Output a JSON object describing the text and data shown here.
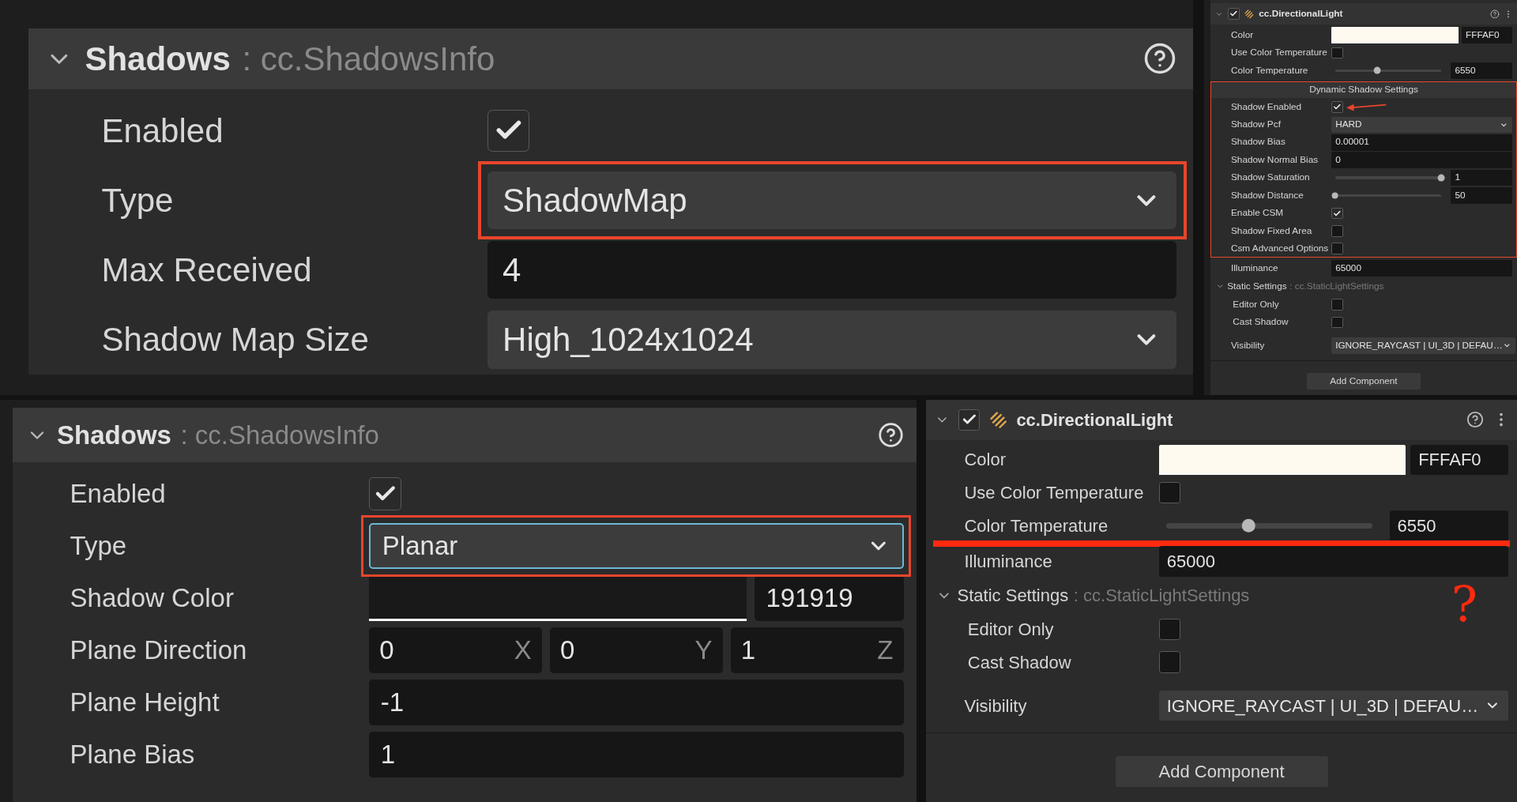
{
  "panels": [
    {
      "kind": "scene",
      "header": {
        "title": "Shadows",
        "type": ": cc.ShadowsInfo",
        "expanded": true
      },
      "rows": [
        {
          "kind": "checkbox",
          "label": "Enabled",
          "checked": true
        },
        {
          "kind": "select",
          "label": "Type",
          "value": "ShadowMap",
          "highlighted": true,
          "focused": false
        },
        {
          "kind": "number",
          "label": "Max Received",
          "value": "4"
        },
        {
          "kind": "select",
          "label": "Shadow Map Size",
          "value": "High_1024x1024",
          "focused": false
        }
      ]
    },
    {
      "kind": "component",
      "header": {
        "title": "cc.DirectionalLight",
        "enabled": true,
        "expanded": true
      },
      "rows": [
        {
          "kind": "color",
          "label": "Color",
          "value": "FFFAF0"
        },
        {
          "kind": "checkbox",
          "label": "Use Color Temperature",
          "checked": false
        },
        {
          "kind": "slider",
          "label": "Color Temperature",
          "level": 0.4,
          "value": "6550"
        },
        {
          "kind": "group",
          "title": "Dynamic Shadow Settings",
          "highlighted": true,
          "children": [
            {
              "kind": "checkbox",
              "label": "Shadow Enabled",
              "checked": true,
              "arrow": true
            },
            {
              "kind": "select",
              "label": "Shadow Pcf",
              "value": "HARD",
              "focused": false
            },
            {
              "kind": "number",
              "label": "Shadow Bias",
              "value": "0.00001"
            },
            {
              "kind": "number",
              "label": "Shadow Normal Bias",
              "value": "0"
            },
            {
              "kind": "slider",
              "label": "Shadow Saturation",
              "level": 1,
              "value": "1"
            },
            {
              "kind": "slider",
              "label": "Shadow Distance",
              "level": 0,
              "value": "50"
            },
            {
              "kind": "checkbox",
              "label": "Enable CSM",
              "checked": true
            },
            {
              "kind": "checkbox",
              "label": "Shadow Fixed Area",
              "checked": false
            },
            {
              "kind": "checkbox",
              "label": "Csm Advanced Options",
              "checked": false
            }
          ]
        },
        {
          "kind": "number",
          "label": "Illuminance",
          "value": "65000"
        },
        {
          "kind": "section",
          "title": "Static Settings",
          "type": ": cc.StaticLightSettings",
          "expanded": true,
          "children": [
            {
              "kind": "checkbox",
              "label": "Editor Only",
              "checked": false
            },
            {
              "kind": "checkbox",
              "label": "Cast Shadow",
              "checked": false
            }
          ]
        },
        {
          "kind": "select",
          "label": "Visibility",
          "value": "IGNORE_RAYCAST | UI_3D | DEFAU…",
          "focused": false
        }
      ],
      "button": "Add Component"
    },
    {
      "kind": "scene",
      "header": {
        "title": "Shadows",
        "type": ": cc.ShadowsInfo",
        "expanded": true
      },
      "rows": [
        {
          "kind": "checkbox",
          "label": "Enabled",
          "checked": true
        },
        {
          "kind": "select",
          "label": "Type",
          "value": "Planar",
          "highlighted": true,
          "focused": true
        },
        {
          "kind": "color",
          "label": "Shadow Color",
          "value": "191919"
        },
        {
          "kind": "vector",
          "label": "Plane Direction",
          "values": [
            {
              "value": "0",
              "axis": "X"
            },
            {
              "value": "0",
              "axis": "Y"
            },
            {
              "value": "1",
              "axis": "Z"
            }
          ]
        },
        {
          "kind": "number",
          "label": "Plane Height",
          "value": "-1"
        },
        {
          "kind": "number",
          "label": "Plane Bias",
          "value": "1"
        }
      ]
    },
    {
      "kind": "component",
      "header": {
        "title": "cc.DirectionalLight",
        "enabled": true,
        "expanded": true
      },
      "rows": [
        {
          "kind": "color",
          "label": "Color",
          "value": "FFFAF0"
        },
        {
          "kind": "checkbox",
          "label": "Use Color Temperature",
          "checked": false
        },
        {
          "kind": "slider",
          "label": "Color Temperature",
          "level": 0.4,
          "value": "6550",
          "marked_below": true
        },
        {
          "kind": "number",
          "label": "Illuminance",
          "value": "65000"
        },
        {
          "kind": "section",
          "title": "Static Settings",
          "type": ": cc.StaticLightSettings",
          "expanded": true,
          "children": [
            {
              "kind": "checkbox",
              "label": "Editor Only",
              "checked": false
            },
            {
              "kind": "checkbox",
              "label": "Cast Shadow",
              "checked": false
            }
          ]
        },
        {
          "kind": "select",
          "label": "Visibility",
          "value": "IGNORE_RAYCAST | UI_3D | DEFAU…",
          "focused": false
        }
      ],
      "button": "Add Component",
      "annotation": "?"
    }
  ]
}
